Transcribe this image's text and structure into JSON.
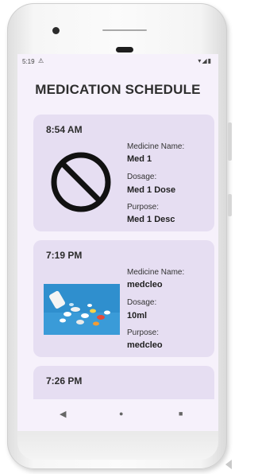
{
  "status_bar": {
    "time": "5:19",
    "alert_icon": "alert-icon",
    "right_icons": "▾◢▮"
  },
  "page": {
    "title": "MEDICATION SCHEDULE"
  },
  "labels": {
    "medicine_name": "Medicine Name:",
    "dosage": "Dosage:",
    "purpose": "Purpose:"
  },
  "medications": [
    {
      "time": "8:54 AM",
      "image": "no-image-placeholder-icon",
      "name": "Med 1",
      "dosage": "Med 1 Dose",
      "purpose": "Med 1 Desc"
    },
    {
      "time": "7:19 PM",
      "image": "pills-photo",
      "name": "medcleo",
      "dosage": "10ml",
      "purpose": "medcleo"
    },
    {
      "time": "7:26 PM"
    }
  ],
  "nav": {
    "back": "◀",
    "home": "●",
    "recents": "■"
  },
  "colors": {
    "screen_bg": "#f6f1fb",
    "card_bg": "#e6def2",
    "title_text": "#2e2e2e",
    "photo_blue": "#2f8fce"
  }
}
